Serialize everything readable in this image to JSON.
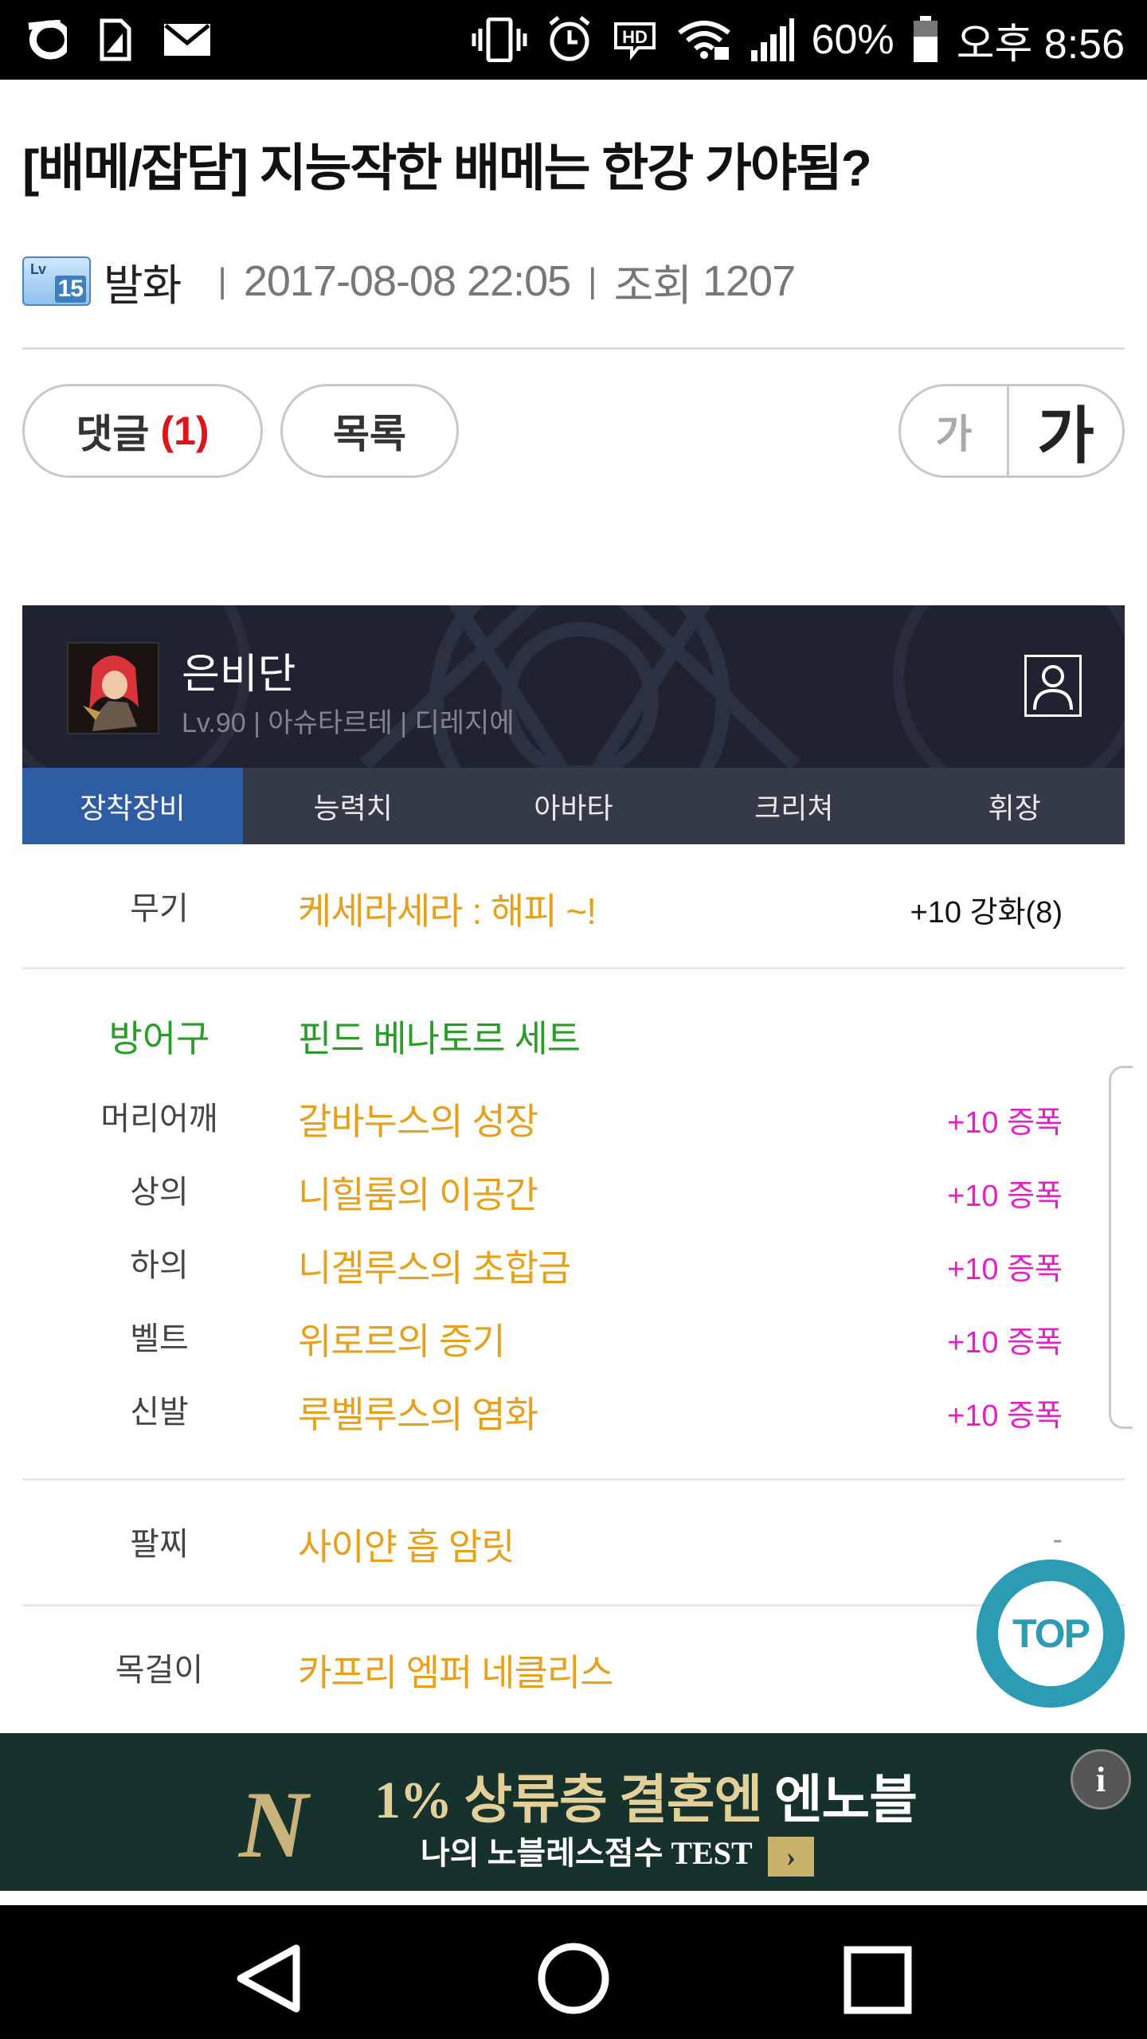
{
  "status_bar": {
    "battery": "60%",
    "time": "오후 8:56",
    "hd_label": "HD",
    "icons": [
      "app-o-icon",
      "sim-icon",
      "mail-icon",
      "vibrate-icon",
      "alarm-icon",
      "hd-icon",
      "wifi-icon",
      "signal-icon",
      "battery-icon"
    ]
  },
  "post": {
    "title": "[배메/잡담] 지능작한 배메는 한강 가야됨?",
    "level_badge": {
      "lv": "Lv",
      "num": "15"
    },
    "author": "발화",
    "datetime": "2017-08-08 22:05",
    "views_label": "조회",
    "views": "1207"
  },
  "actions": {
    "comment_label": "댓글",
    "comment_count": "(1)",
    "list_label": "목록",
    "font_small": "가",
    "font_large": "가"
  },
  "character": {
    "name": "은비단",
    "info": "Lv.90 | 아슈타르테 | 디레지에",
    "tabs": [
      {
        "label": "장착장비",
        "active": true
      },
      {
        "label": "능력치",
        "active": false
      },
      {
        "label": "아바타",
        "active": false
      },
      {
        "label": "크리쳐",
        "active": false
      },
      {
        "label": "휘장",
        "active": false
      }
    ]
  },
  "equipment": {
    "weapon": {
      "slot": "무기",
      "item": "케세라세라 : 해피 ~!",
      "enhance": "+10 강화(8)"
    },
    "armor_header": {
      "slot": "방어구",
      "set": "핀드 베나토르 세트"
    },
    "armor": [
      {
        "slot": "머리어깨",
        "item": "갈바누스의 성장",
        "enhance": "+10 증폭"
      },
      {
        "slot": "상의",
        "item": "니힐룸의 이공간",
        "enhance": "+10 증폭"
      },
      {
        "slot": "하의",
        "item": "니겔루스의 초합금",
        "enhance": "+10 증폭"
      },
      {
        "slot": "벨트",
        "item": "위로르의 증기",
        "enhance": "+10 증폭"
      },
      {
        "slot": "신발",
        "item": "루벨루스의 염화",
        "enhance": "+10 증폭"
      }
    ],
    "bracelet": {
      "slot": "팔찌",
      "item": "사이얀 흡 암릿",
      "enhance": "-"
    },
    "necklace": {
      "slot": "목걸이",
      "item": "카프리 엠퍼 네클리스"
    }
  },
  "top_button": "TOP",
  "ad": {
    "logo": "N",
    "headline_1": "1% 상류층 결혼엔",
    "headline_2": "엔노블",
    "sub": "나의 노블레스점수 TEST",
    "arrow": "›",
    "info": "i"
  },
  "colors": {
    "item_gold": "#e5a11c",
    "armor_green": "#2a9c28",
    "amplify_magenta": "#e41fc8",
    "tab_active": "#2e5da3",
    "comment_red": "#e0121c",
    "top_teal": "#2b9cb3"
  }
}
